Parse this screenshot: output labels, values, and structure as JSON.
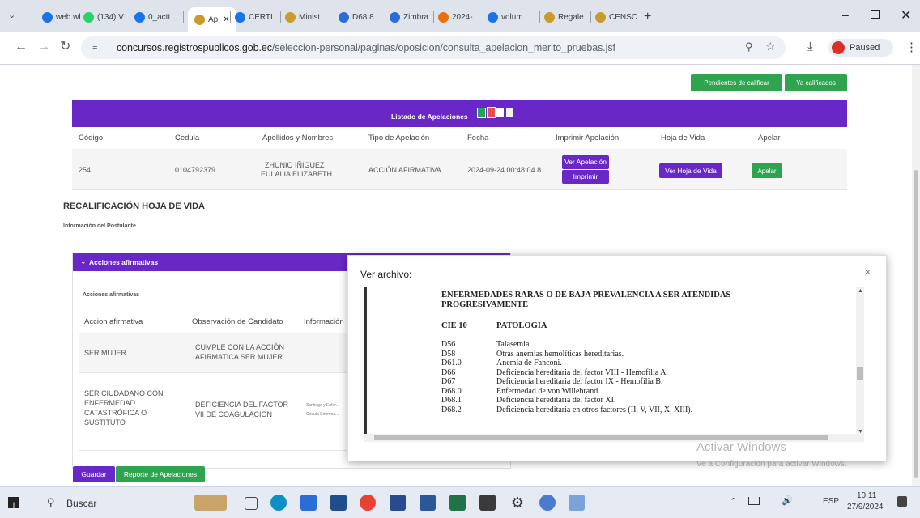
{
  "browser": {
    "tabs": [
      {
        "label": "web.wl",
        "color": "#1a73e8"
      },
      {
        "label": "(134) V",
        "color": "#25d366"
      },
      {
        "label": "0_actt",
        "color": "#1a73e8"
      },
      {
        "label": "Ap",
        "color": "#c89b2a"
      },
      {
        "label": "CERTI",
        "color": "#1a73e8"
      },
      {
        "label": "Minist",
        "color": "#c89b2a"
      },
      {
        "label": "D68.8",
        "color": "#2b6cd6"
      },
      {
        "label": "Zimbra",
        "color": "#2b6cd6"
      },
      {
        "label": "2024-",
        "color": "#e8710a"
      },
      {
        "label": "volum",
        "color": "#1a73e8"
      },
      {
        "label": "Regale",
        "color": "#c89b2a"
      },
      {
        "label": "CENSC",
        "color": "#c89b2a"
      }
    ],
    "new_tab": "+",
    "url_prefix": "concursos.registrospublicos.gob.ec",
    "url_path": "/seleccion-personal/paginas/oposicion/consulta_apelacion_merito_pruebas.jsf",
    "profile_label": "Paused"
  },
  "page": {
    "btn_pending": "Pendientes de calificar",
    "btn_graded": "Ya calificados",
    "table_title": "Listado de Apelaciones",
    "headers": [
      "Código",
      "Cedula",
      "Apellidos y Nombres",
      "Tipo de Apelación",
      "Fecha",
      "Imprimir Apelación",
      "Hoja de Vida",
      "Apelar"
    ],
    "row": {
      "codigo": "254",
      "cedula": "0104792379",
      "nombre_1": "ZHUNIO IÑIGUEZ",
      "nombre_2": "EULALIA ELIZABETH",
      "tipo": "ACCIÓN AFIRMATIVA",
      "fecha": "2024-09-24 00:48:04.8",
      "btn_ver": "Ver Apelación",
      "btn_imprimir": "Imprimir",
      "btn_hoja": "Ver Hoja de Vida",
      "btn_apelar": "Apelar"
    },
    "section_title": "RECALIFICACIÓN HOJA DE VIDA",
    "section_sub": "Información del Postulante",
    "accordion_title": "Acciones afirmativas",
    "accordion_sub": "Acciones afirmativas",
    "inner_headers": [
      "Accion afirmativa",
      "Observación de Candidato",
      "Información"
    ],
    "inner_rows": [
      {
        "accion": "SER MUJER",
        "obs_1": "CUMPLE CON LA ACCIÓN",
        "obs_2": "AFIRMATICA SER MUJER",
        "info_1": "",
        "info_2": ""
      },
      {
        "accion_1": "SER CIUDADANO CON",
        "accion_2": "ENFERMEDAD",
        "accion_3": "CATASTRÓFICA O",
        "accion_4": "SUSTITUTO",
        "obs_1": "DEFICIENCIA DEL FACTOR",
        "obs_2": "VII DE COAGULACION",
        "info_1": "Santiago y Enfer...",
        "info_2": "Cédula Enferma..."
      }
    ],
    "btn_guardar": "Guardar",
    "btn_reporte": "Reporte de Apelaciones"
  },
  "modal": {
    "title": "Ver archivo:",
    "close": "×",
    "doc_title_1": "ENFERMEDADES RARAS O DE BAJA PREVALENCIA A SER ATENDIDAS",
    "doc_title_2": "PROGRESIVAMENTE",
    "col_1": "CIE 10",
    "col_2": "PATOLOGÍA",
    "rows": [
      {
        "code": "D56",
        "name": "Talasemia."
      },
      {
        "code": "D58",
        "name": "Otras anemias hemolíticas hereditarias."
      },
      {
        "code": "D61.0",
        "name": "Anemia de Fanconi."
      },
      {
        "code": "D66",
        "name": "Deficiencia hereditaria del factor VIII - Hemofilia A."
      },
      {
        "code": "D67",
        "name": "Deficiencia hereditaria del factor IX - Hemofilia B."
      },
      {
        "code": "D68.0",
        "name": "Enfermedad de von Willebrand."
      },
      {
        "code": "D68.1",
        "name": "Deficiencia hereditaria del factor XI."
      },
      {
        "code": "D68.2",
        "name": "Deficiencia hereditaria en otros factores (II, V, VII, X, XIII)."
      }
    ]
  },
  "watermark": {
    "line1": "Activar Windows",
    "line2": "Ve a Configuración para activar Windows."
  },
  "taskbar": {
    "search": "Buscar",
    "lang": "ESP",
    "time": "10:11",
    "date": "27/9/2024"
  }
}
